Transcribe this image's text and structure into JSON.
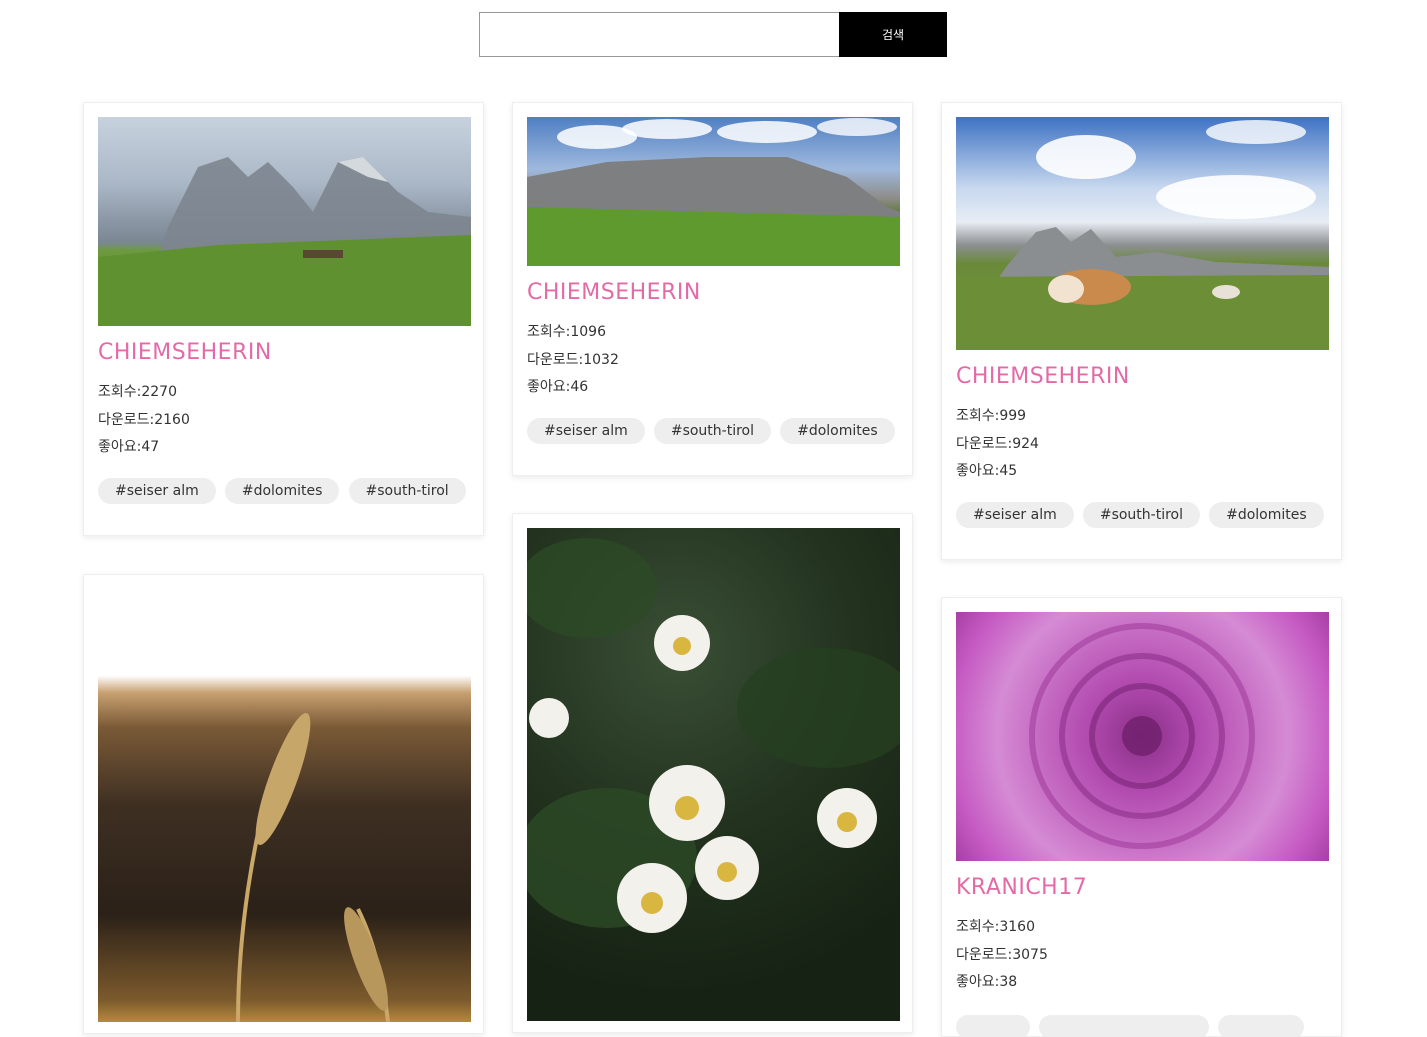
{
  "search": {
    "placeholder": "",
    "button_label": "검색"
  },
  "accent_color": "#e46aa7",
  "cards": [
    {
      "title": "CHIEMSEHERIN",
      "image": "mountain-meadow-photo",
      "views": "조회수:2270",
      "downloads": "다운로드:2160",
      "likes": "좋아요:47",
      "tags": [
        "#seiser alm",
        "#dolomites",
        "#south-tirol"
      ]
    },
    {
      "title": "CHIEMSEHERIN",
      "image": "alpine-panorama-photo",
      "views": "조회수:1096",
      "downloads": "다운로드:1032",
      "likes": "좋아요:46",
      "tags": [
        "#seiser alm",
        "#south-tirol",
        "#dolomites"
      ]
    },
    {
      "title": "CHIEMSEHERIN",
      "image": "cows-grazing-photo",
      "views": "조회수:999",
      "downloads": "다운로드:924",
      "likes": "좋아요:45",
      "tags": [
        "#seiser alm",
        "#south-tirol",
        "#dolomites"
      ]
    },
    {
      "image": "wheat-sunset-photo"
    },
    {
      "image": "white-lotus-photo"
    },
    {
      "title": "KRANICH17",
      "image": "purple-rose-photo",
      "views": "조회수:3160",
      "downloads": "다운로드:3075",
      "likes": "좋아요:38"
    }
  ]
}
